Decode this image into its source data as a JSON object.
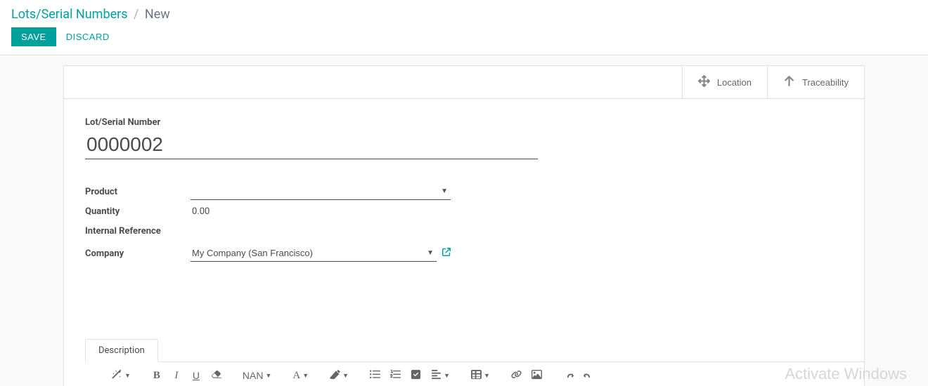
{
  "breadcrumb": {
    "root": "Lots/Serial Numbers",
    "current": "New"
  },
  "actions": {
    "save": "SAVE",
    "discard": "DISCARD"
  },
  "stat_buttons": {
    "location": "Location",
    "traceability": "Traceability"
  },
  "form": {
    "lot_label": "Lot/Serial Number",
    "lot_value": "0000002",
    "fields": {
      "product": {
        "label": "Product",
        "value": ""
      },
      "quantity": {
        "label": "Quantity",
        "value": "0.00"
      },
      "internal_ref": {
        "label": "Internal Reference",
        "value": ""
      },
      "company": {
        "label": "Company",
        "value": "My Company (San Francisco)"
      }
    }
  },
  "tabs": {
    "description": "Description"
  },
  "toolbar": {
    "font_size": "NAN"
  },
  "watermark": "Activate Windows"
}
